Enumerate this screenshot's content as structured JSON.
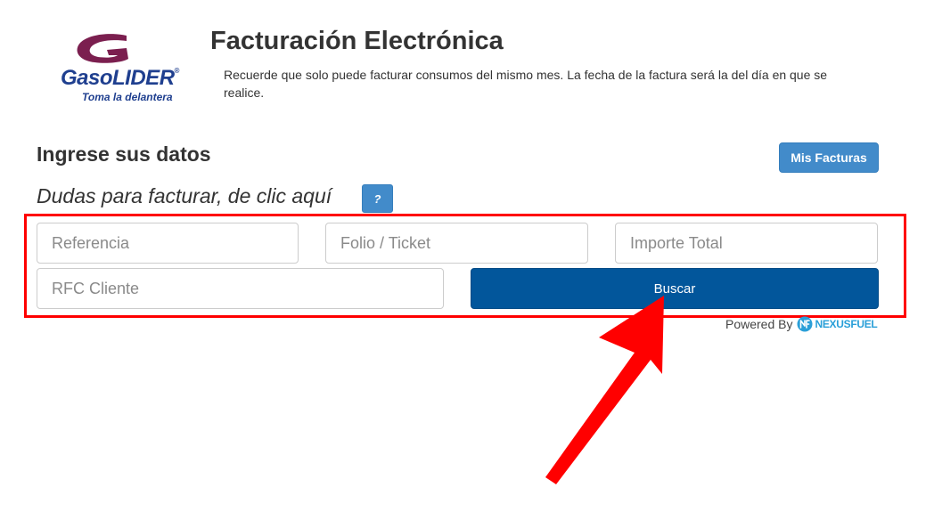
{
  "brand": {
    "name": "GasoLIDER",
    "registered_mark": "®",
    "tagline": "Toma la delantera",
    "primary_color": "#7b1f4f",
    "text_color": "#1f3f8f"
  },
  "header": {
    "title": "Facturación Electrónica",
    "notice": "Recuerde que solo puede facturar consumos del mismo mes. La fecha de la factura será la del día en que se realice."
  },
  "section": {
    "title": "Ingrese sus datos",
    "help_text": "Dudas para facturar, de clic aquí",
    "help_button_label": "?",
    "my_invoices_label": "Mis Facturas"
  },
  "form": {
    "referencia_placeholder": "Referencia",
    "folio_placeholder": "Folio / Ticket",
    "importe_placeholder": "Importe Total",
    "rfc_placeholder": "RFC Cliente",
    "search_label": "Buscar"
  },
  "footer": {
    "powered_by": "Powered By",
    "provider": "NEXUSFUEL"
  },
  "annotations": {
    "highlight_color": "#ff0000",
    "arrow_color": "#ff0000"
  },
  "icons": {
    "logo": "gasolider-g-logo",
    "provider_logo": "nexusfuel-logo",
    "arrow": "red-pointer-arrow"
  }
}
